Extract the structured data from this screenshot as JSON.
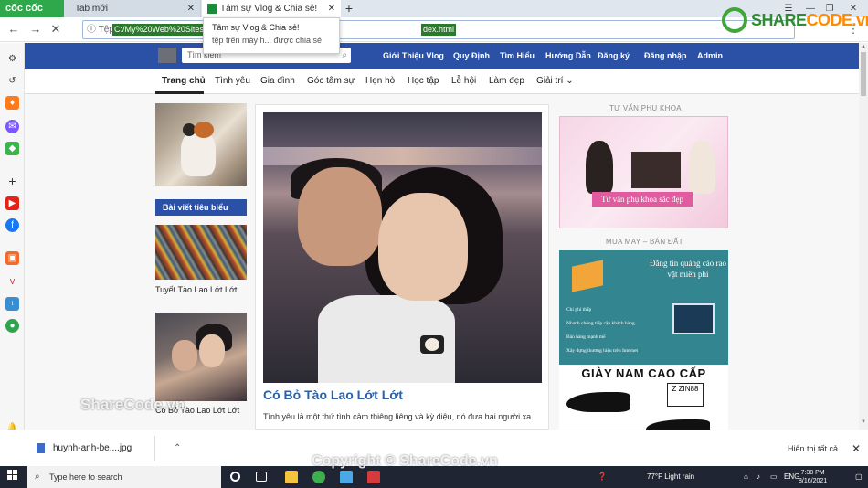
{
  "browser": {
    "brand": "cốc cốc",
    "tabs": [
      {
        "label": "Tab mới"
      },
      {
        "label": "Tâm sự Vlog & Chia sẻ!"
      }
    ],
    "tooltip": {
      "title": "Tâm sự Vlog & Chia sẻ!",
      "subtitle": "tệp trên máy h... được chia sẻ"
    },
    "address": {
      "scheme_label": "Tệp",
      "url_part1": "C:/My%20Web%20Sites/v",
      "url_part2": "dex.html"
    },
    "download": {
      "filename": "huynh-anh-be....jpg",
      "show_all": "Hiển thị tất cả"
    }
  },
  "overlay_logo": {
    "brand_a": "SHARE",
    "brand_b": "CODE.vn"
  },
  "site": {
    "search_placeholder": "Tìm kiếm",
    "top_links": [
      "Giới Thiệu Vlog",
      "Quy Định",
      "Tìm Hiểu",
      "Hướng Dẫn",
      "Đăng ký",
      "Đăng nhập",
      "Admin"
    ],
    "categories": [
      "Trang chủ",
      "Tình yêu",
      "Gia đình",
      "Góc tâm sự",
      "Hẹn hò",
      "Học tập",
      "Lễ hội",
      "Làm đẹp",
      "Giải trí ⌄"
    ],
    "featured_label": "Bài viết tiêu biểu",
    "left_captions": [
      "Tuyết Tào Lao Lớt Lớt",
      "Có Bỏ Tào Lao Lớt Lớt"
    ],
    "article": {
      "title": "Có Bỏ Tào Lao Lớt Lớt",
      "excerpt": "Tình yêu là một thứ tình cảm thiêng liêng và kỳ diệu, nó đưa hai người xa"
    },
    "right": {
      "head1": "TƯ VẤN PHỤ KHOA",
      "ad1_banner": "Tư vấn phụ khoa sắc đẹp",
      "head2": "MUA MAY – BÁN ĐẤT",
      "ad2_title": "Đăng tin quảng cáo rao vặt miễn phí",
      "ad2_items": [
        "Chi phí thấp",
        "Nhanh chóng tiếp cận khách hàng",
        "Bán hàng mạnh mẽ",
        "Xây dựng thương hiệu trên Internet"
      ],
      "ad3_title": "GIÀY NAM CAO CẤP",
      "ad3_logo": "Z ZIN88"
    }
  },
  "watermark": {
    "top": "ShareCode.vn",
    "bottom": "Copyright © ShareCode.vn"
  },
  "taskbar": {
    "search_placeholder": "Type here to search",
    "weather": "77°F  Light rain",
    "lang": "ENG",
    "time": "7:38 PM",
    "date": "8/16/2021"
  }
}
